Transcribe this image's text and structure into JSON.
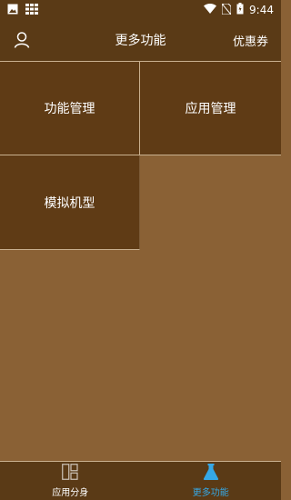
{
  "status_bar": {
    "time": "9:44",
    "icons": [
      "image-icon",
      "grid-icon",
      "wifi-icon",
      "no-sim-icon",
      "battery-icon"
    ]
  },
  "header": {
    "title": "更多功能",
    "right_action": "优惠券",
    "left_icon": "user-icon"
  },
  "grid": {
    "tiles": [
      {
        "label": "功能管理"
      },
      {
        "label": "应用管理"
      },
      {
        "label": "模拟机型"
      }
    ]
  },
  "tabbar": {
    "tabs": [
      {
        "label": "应用分身",
        "icon": "apps-icon",
        "active": false
      },
      {
        "label": "更多功能",
        "icon": "flask-icon",
        "active": true
      }
    ]
  },
  "colors": {
    "header_bg": "#5a3a16",
    "tile_bg": "#5f3b15",
    "page_bg": "#8a6135",
    "divider": "#c9b08f",
    "active_tab": "#35a8e6"
  }
}
